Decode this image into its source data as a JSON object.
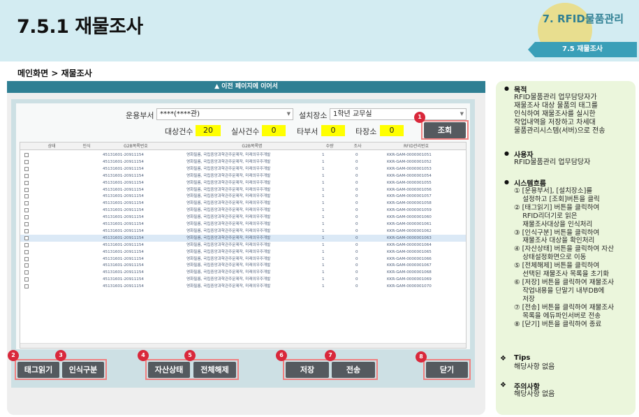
{
  "header": {
    "title": "7.5.1 재물조사",
    "section": "7. RFID물품관리",
    "ribbon": "7.5 재물조사"
  },
  "breadcrumb": "메인화면 > 재물조사",
  "continue_bar": "▲ 이전 페이지에 이어서",
  "form": {
    "dept_label": "운용부서",
    "dept_value": "****(****관)",
    "place_label": "설치장소",
    "place_value": "1학년 교무실",
    "target_label": "대상건수",
    "target_value": "20",
    "actual_label": "실사건수",
    "actual_value": "0",
    "other_dept_label": "타부서",
    "other_dept_value": "0",
    "other_place_label": "타장소",
    "other_place_value": "0",
    "search_button": "조회"
  },
  "grid": {
    "columns": [
      "상태",
      "인식",
      "G2B목록번호",
      "G2B목록명",
      "수량",
      "조사",
      "RFID관리번호"
    ],
    "rows": [
      {
        "g2b_no": "45131601-20911154",
        "g2b_name": "영화필름, 국립중앙과학관주문제작, 미래의우주개발",
        "qty": "1",
        "check": "0",
        "rfid": "KKR-GAM-0000001051"
      },
      {
        "g2b_no": "45131601-20911154",
        "g2b_name": "영화필름, 국립중앙과학관주문제작, 미래의우주개발",
        "qty": "1",
        "check": "0",
        "rfid": "KKR-GAM-0000001052"
      },
      {
        "g2b_no": "45131601-20911154",
        "g2b_name": "영화필름, 국립중앙과학관주문제작, 미래의우주개발",
        "qty": "1",
        "check": "0",
        "rfid": "KKR-GAM-0000001053"
      },
      {
        "g2b_no": "45131601-20911154",
        "g2b_name": "영화필름, 국립중앙과학관주문제작, 미래의우주개발",
        "qty": "1",
        "check": "0",
        "rfid": "KKR-GAM-0000001054"
      },
      {
        "g2b_no": "45131601-20911154",
        "g2b_name": "영화필름, 국립중앙과학관주문제작, 미래의우주개발",
        "qty": "1",
        "check": "0",
        "rfid": "KKR-GAM-0000001055"
      },
      {
        "g2b_no": "45131601-20911154",
        "g2b_name": "영화필름, 국립중앙과학관주문제작, 미래의우주개발",
        "qty": "1",
        "check": "0",
        "rfid": "KKR-GAM-0000001056"
      },
      {
        "g2b_no": "45131601-20911154",
        "g2b_name": "영화필름, 국립중앙과학관주문제작, 미래의우주개발",
        "qty": "1",
        "check": "0",
        "rfid": "KKR-GAM-0000001057"
      },
      {
        "g2b_no": "45131601-20911154",
        "g2b_name": "영화필름, 국립중앙과학관주문제작, 미래의우주개발",
        "qty": "1",
        "check": "0",
        "rfid": "KKR-GAM-0000001058"
      },
      {
        "g2b_no": "45131601-20911154",
        "g2b_name": "영화필름, 국립중앙과학관주문제작, 미래의우주개발",
        "qty": "1",
        "check": "0",
        "rfid": "KKR-GAM-0000001059"
      },
      {
        "g2b_no": "45131601-20911154",
        "g2b_name": "영화필름, 국립중앙과학관주문제작, 미래의우주개발",
        "qty": "1",
        "check": "0",
        "rfid": "KKR-GAM-0000001060"
      },
      {
        "g2b_no": "45131601-20911154",
        "g2b_name": "영화필름, 국립중앙과학관주문제작, 미래의우주개발",
        "qty": "1",
        "check": "0",
        "rfid": "KKR-GAM-0000001061"
      },
      {
        "g2b_no": "45131601-20911154",
        "g2b_name": "영화필름, 국립중앙과학관주문제작, 미래의우주개발",
        "qty": "1",
        "check": "0",
        "rfid": "KKR-GAM-0000001062"
      },
      {
        "g2b_no": "45131601-20911154",
        "g2b_name": "영화필름, 국립중앙과학관주문제작, 미래의우주개발",
        "qty": "1",
        "check": "0",
        "rfid": "KKR-GAM-0000001063"
      },
      {
        "g2b_no": "45131601-20911154",
        "g2b_name": "영화필름, 국립중앙과학관주문제작, 미래의우주개발",
        "qty": "1",
        "check": "0",
        "rfid": "KKR-GAM-0000001064"
      },
      {
        "g2b_no": "45131601-20911154",
        "g2b_name": "영화필름, 국립중앙과학관주문제작, 미래의우주개발",
        "qty": "1",
        "check": "0",
        "rfid": "KKR-GAM-0000001065"
      },
      {
        "g2b_no": "45131601-20911154",
        "g2b_name": "영화필름, 국립중앙과학관주문제작, 미래의우주개발",
        "qty": "1",
        "check": "0",
        "rfid": "KKR-GAM-0000001066"
      },
      {
        "g2b_no": "45131601-20911154",
        "g2b_name": "영화필름, 국립중앙과학관주문제작, 미래의우주개발",
        "qty": "1",
        "check": "0",
        "rfid": "KKR-GAM-0000001067"
      },
      {
        "g2b_no": "45131601-20911154",
        "g2b_name": "영화필름, 국립중앙과학관주문제작, 미래의우주개발",
        "qty": "1",
        "check": "0",
        "rfid": "KKR-GAM-0000001068"
      },
      {
        "g2b_no": "45131601-20911154",
        "g2b_name": "영화필름, 국립중앙과학관주문제작, 미래의우주개발",
        "qty": "1",
        "check": "0",
        "rfid": "KKR-GAM-0000001069"
      },
      {
        "g2b_no": "45131601-20911154",
        "g2b_name": "영화필름, 국립중앙과학관주문제작, 미래의우주개발",
        "qty": "1",
        "check": "0",
        "rfid": "KKR-GAM-0000001070"
      }
    ],
    "selected_row": 12
  },
  "buttons": {
    "tag_read": "태그읽기",
    "recognize_type": "인식구분",
    "asset_status": "자산상태",
    "release_all": "전체해제",
    "save": "저장",
    "send": "전송",
    "close": "닫기"
  },
  "markers": [
    "1",
    "2",
    "3",
    "4",
    "5",
    "6",
    "7",
    "8"
  ],
  "side": {
    "purpose_head": "목적",
    "purpose_lines": [
      "RFID물품관리 업무담당자가",
      "재물조사 대상 물품의 태그를",
      "인식하여 재물조사를 실시한",
      "작업내역을 저장하고 차세대",
      "물품관리시스템(서버)으로 전송"
    ],
    "user_head": "사용자",
    "user_text": "RFID물품관리 업무담당자",
    "flow_head": "시스템흐름",
    "flow_lines": [
      "① [운용부서], [설치장소]를",
      "    설정하고 [조회]버튼을 클릭",
      "② [태그읽기] 버튼을 클릭하여",
      "    RFID리더기로 읽은",
      "    재물조사대상을 인식처리",
      "③ [인식구분] 버튼을 클릭하여",
      "    재물조사 대상을 확인처리",
      "④ [자산상태] 버튼을 클릭하여 자산",
      "    상태설정화면으로 이동",
      "⑤ [전체해제] 버튼을 클릭하여",
      "    선택된 재물조사 목록을 초기화",
      "⑥ [저장] 버튼을 클릭하여 재물조사",
      "    작업내용을 단말기 내부DB에",
      "    저장",
      "⑦ [전송] 버튼을 클릭하여 재물조사",
      "    목록을 에듀파인서버로 전송",
      "⑧ [닫기] 버튼을 클릭하여 종료"
    ],
    "tips_head": "Tips",
    "tips_text": "해당사항 없음",
    "notes_head": "주의사항",
    "notes_text": "해당사항 없음"
  }
}
